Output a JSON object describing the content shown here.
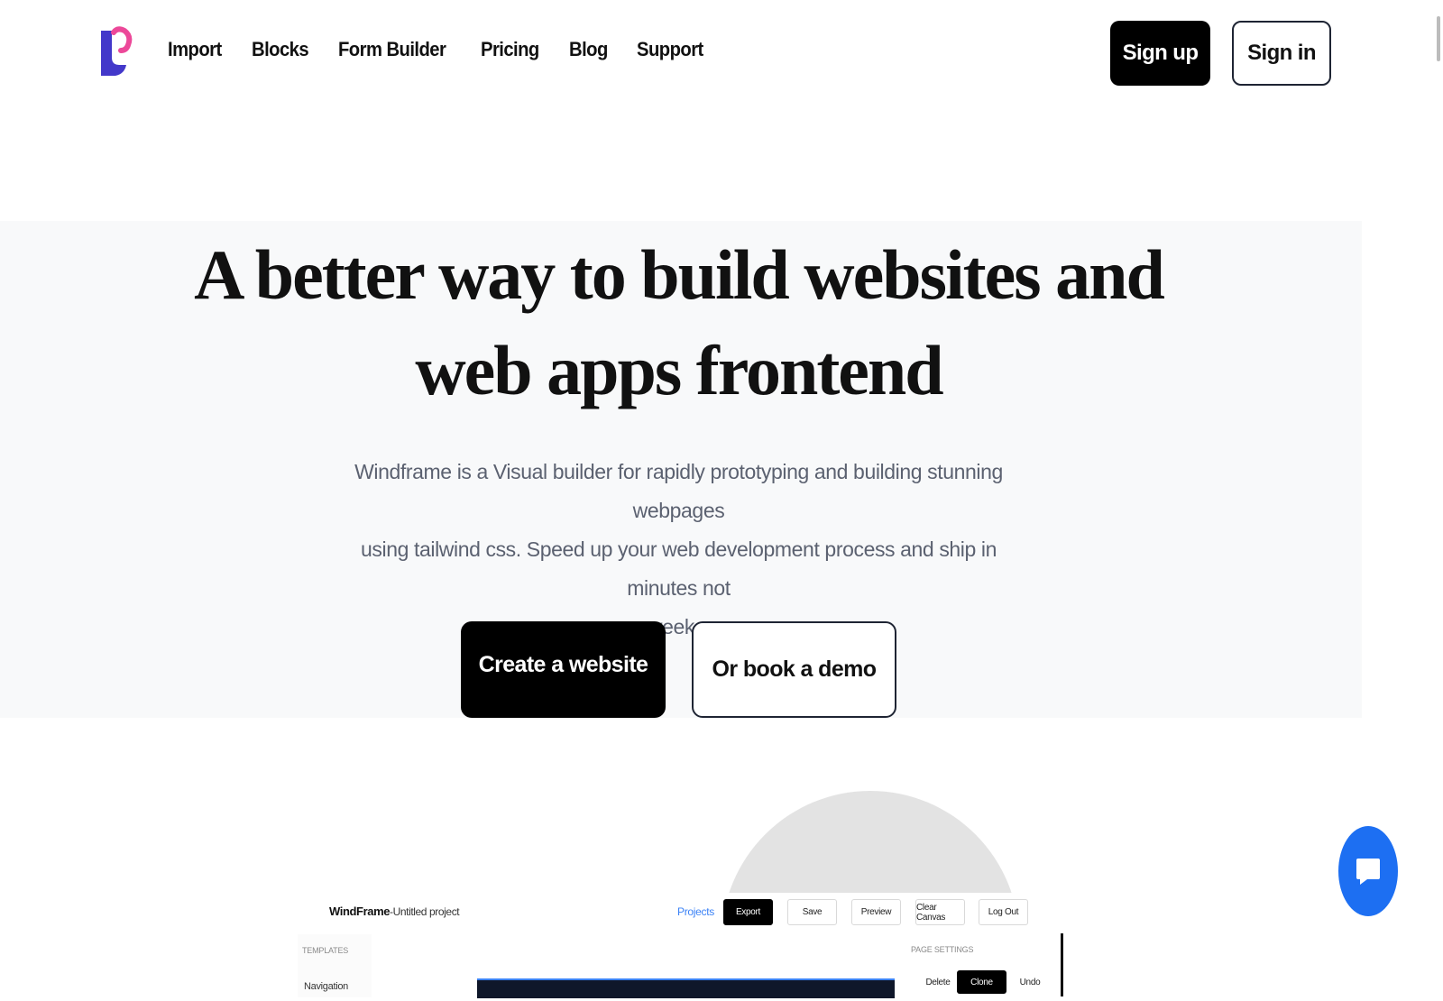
{
  "header": {
    "nav": [
      "Import",
      "Blocks",
      "Form Builder",
      "Pricing",
      "Blog",
      "Support"
    ],
    "signup_label": "Sign up",
    "signin_label": "Sign in"
  },
  "hero": {
    "title_line1": "A better way to build websites and",
    "title_line2": "web apps frontend",
    "subtitle_line1": "Windframe is a Visual builder for rapidly prototyping and building stunning webpages",
    "subtitle_line2": "using tailwind css. Speed up your web development process and ship in minutes not",
    "subtitle_line3": "weeks.",
    "primary_cta": "Create a website",
    "secondary_cta": "Or book a demo"
  },
  "preview": {
    "brand": "WindFrame",
    "project": "-Untitled project",
    "projects_link": "Projects",
    "toolbar": [
      "Export",
      "Save",
      "Preview",
      "Clear Canvas",
      "Log Out"
    ],
    "left_panel_heading": "TEMPLATES",
    "left_panel_item": "Navigation",
    "right_panel_heading": "PAGE SETTINGS",
    "right_actions": [
      "Delete",
      "Clone",
      "Undo"
    ]
  },
  "colors": {
    "accent_blue": "#1d6ff2",
    "link_blue": "#3b82f6",
    "logo_blue": "#4338ca",
    "logo_pink": "#ec4899"
  },
  "icons": {
    "logo": "windframe-logo",
    "chat": "chat-bubble-icon"
  }
}
